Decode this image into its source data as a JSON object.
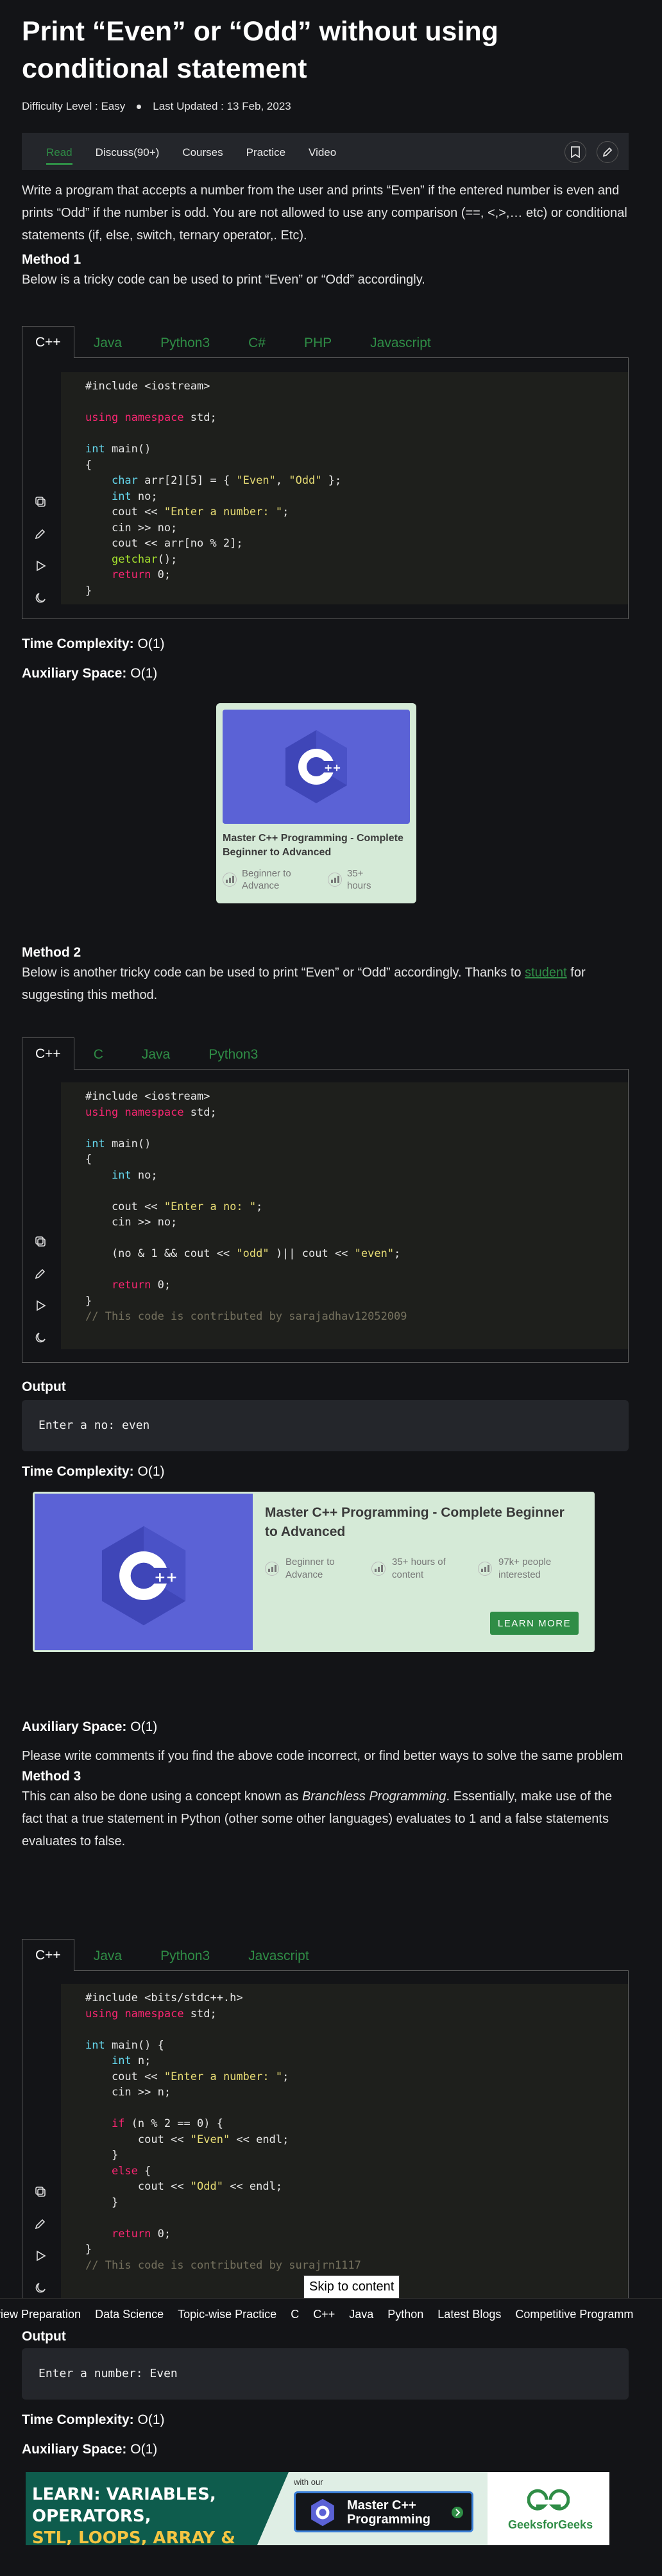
{
  "article": {
    "title": "Print “Even” or “Odd” without using conditional statement",
    "difficulty": "Difficulty Level : Easy",
    "updated": "Last Updated : 13 Feb, 2023"
  },
  "tabs": [
    "Read",
    "Discuss(90+)",
    "Courses",
    "Practice",
    "Video"
  ],
  "intro": "Write a program that accepts a number from the user and prints “Even” if the entered number is even and prints “Odd” if the number is odd. You are not allowed to use any comparison (==, <,>,… etc) or conditional statements (if, else, switch, ternary operator,. Etc).",
  "method1": {
    "heading": "Method 1",
    "desc": "Below is a tricky code can be used to print “Even” or “Odd” accordingly.",
    "langs": [
      "C++",
      "Java",
      "Python3",
      "C#",
      "PHP",
      "Javascript"
    ],
    "time": "Time Complexity:",
    "time_val": " O(1)",
    "space": "Auxiliary Space:",
    "space_val": " O(1)"
  },
  "course_card": {
    "title": "Master C++ Programming - Complete Beginner to Advanced",
    "level": "Beginner to Advance",
    "hours": "35+ hours"
  },
  "method2": {
    "heading": "Method 2",
    "desc_a": "Below is another tricky code can be used to print “Even” or “Odd” accordingly. Thanks to ",
    "desc_link": "student",
    "desc_b": " for suggesting this method.",
    "langs": [
      "C++",
      "C",
      "Java",
      "Python3"
    ],
    "output_label": "Output",
    "output": "Enter a no: even",
    "time": "Time Complexity:",
    "time_val": " O(1)",
    "space": "Auxiliary Space:",
    "space_val": " O(1)",
    "comment_note": "Please write comments if you find the above code incorrect, or find better ways to solve the same problem"
  },
  "wide_banner": {
    "title": "Master C++ Programming - Complete Beginner to Advanced",
    "level": "Beginner to Advance",
    "hours": "35+ hours of content",
    "people": "97k+ people interested",
    "button": "LEARN MORE"
  },
  "method3": {
    "heading": "Method 3",
    "desc_a": "This can also be done using a concept known as ",
    "desc_em": "Branchless Programming",
    "desc_b": ". Essentially, make use of the fact that a true statement in Python (other some other languages) evaluates to 1 and a false statements evaluates to false.",
    "langs": [
      "C++",
      "Java",
      "Python3",
      "Javascript"
    ],
    "output_label": "Output",
    "output": "Enter a number: Even",
    "time": "Time Complexity:",
    "time_val": " O(1)",
    "space": "Auxiliary Space:",
    "space_val": " O(1)"
  },
  "skip_link": "Skip to content",
  "nav_strip": [
    "view Preparation",
    "Data Science",
    "Topic-wise Practice",
    "C",
    "C++",
    "Java",
    "Python",
    "Latest Blogs",
    "Competitive Programm"
  ],
  "ad": {
    "line1": "LEARN: VARIABLES, OPERATORS,",
    "line2": "STL, LOOPS, ARRAY & BECOME A++",
    "with": "with our",
    "course": "Master C++ Programming",
    "brand": "GeeksforGeeks"
  },
  "colors": {
    "accent": "#2f8d46",
    "bg": "#131417",
    "panel": "#24262b",
    "banner": "#5b62d6"
  }
}
